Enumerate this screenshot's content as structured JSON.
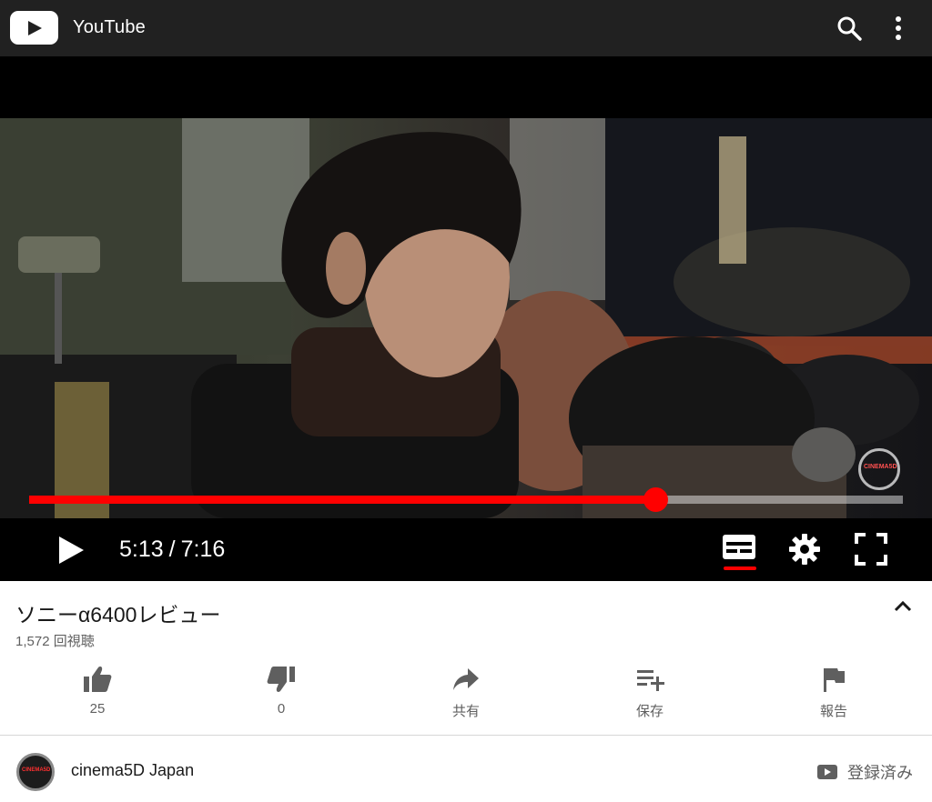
{
  "app": {
    "name": "YouTube",
    "icons": [
      "youtube-logo-icon",
      "search-icon",
      "more-vert-icon"
    ]
  },
  "player": {
    "current_time": "5:13",
    "separator": "/",
    "duration": "7:16",
    "progress_percent": 71.7,
    "watermark_icon": "cinema5d-watermark-icon",
    "controls": [
      "play-icon",
      "captions-icon",
      "settings-icon",
      "fullscreen-icon"
    ],
    "accent_color": "#ff0000"
  },
  "video": {
    "title": "ソニーα6400レビュー",
    "views": "1,572 回視聴"
  },
  "actions": [
    {
      "key": "like",
      "icon": "thumbs-up-icon",
      "label": "25"
    },
    {
      "key": "dislike",
      "icon": "thumbs-down-icon",
      "label": "0"
    },
    {
      "key": "share",
      "icon": "share-icon",
      "label": "共有"
    },
    {
      "key": "save",
      "icon": "playlist-add-icon",
      "label": "保存"
    },
    {
      "key": "report",
      "icon": "flag-icon",
      "label": "報告"
    }
  ],
  "channel": {
    "name": "cinema5D Japan",
    "avatar_text": "CINEMA5D",
    "subscribed_label": "登録済み"
  }
}
